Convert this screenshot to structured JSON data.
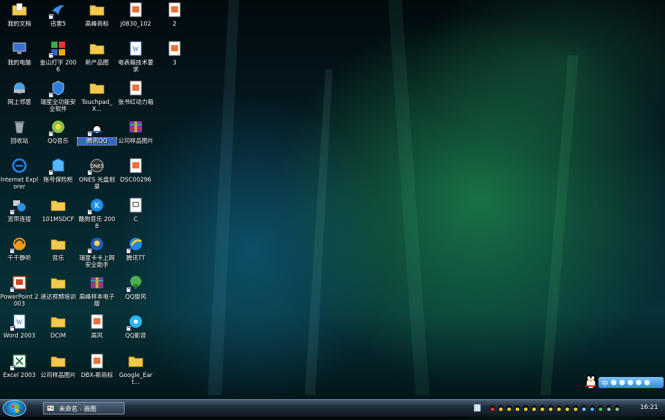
{
  "desktop": {
    "col1": [
      {
        "label": "我的文档",
        "icon": "documents-folder-icon",
        "shortcut": false
      },
      {
        "label": "我的电脑",
        "icon": "computer-icon",
        "shortcut": false
      },
      {
        "label": "网上邻居",
        "icon": "network-icon",
        "shortcut": false
      },
      {
        "label": "回收站",
        "icon": "recycle-bin-icon",
        "shortcut": false
      },
      {
        "label": "Internet Explorer",
        "icon": "internet-explorer-icon",
        "shortcut": false
      },
      {
        "label": "宽带连接",
        "icon": "broadband-connection-icon",
        "shortcut": true
      },
      {
        "label": "千千静听",
        "icon": "ttplayer-icon",
        "shortcut": true
      },
      {
        "label": "PowerPoint 2003",
        "icon": "powerpoint-icon",
        "shortcut": true
      },
      {
        "label": "Word 2003",
        "icon": "word-icon",
        "shortcut": true
      },
      {
        "label": "Excel 2003",
        "icon": "excel-icon",
        "shortcut": true
      }
    ],
    "col2": [
      {
        "label": "迅雷5",
        "icon": "thunder-icon",
        "shortcut": true
      },
      {
        "label": "金山打字 2006",
        "icon": "kingsoft-typing-icon",
        "shortcut": true
      },
      {
        "label": "瑞星全功能安全软件",
        "icon": "rising-security-icon",
        "shortcut": true
      },
      {
        "label": "QQ音乐",
        "icon": "qq-music-icon",
        "shortcut": true
      },
      {
        "label": "账号保险柜",
        "icon": "account-safe-icon",
        "shortcut": true
      },
      {
        "label": "101MSDCF",
        "icon": "folder-icon",
        "shortcut": false
      },
      {
        "label": "音乐",
        "icon": "folder-icon",
        "shortcut": false
      },
      {
        "label": "速达视频培训",
        "icon": "folder-icon",
        "shortcut": false
      },
      {
        "label": "DCIM",
        "icon": "folder-icon",
        "shortcut": false
      },
      {
        "label": "公司样品图片",
        "icon": "folder-icon",
        "shortcut": false
      }
    ],
    "col3": [
      {
        "label": "高峰商标",
        "icon": "folder-icon",
        "shortcut": false
      },
      {
        "label": "新产品图",
        "icon": "folder-icon",
        "shortcut": false
      },
      {
        "label": "Touchpad_X...",
        "icon": "folder-icon",
        "shortcut": false
      },
      {
        "label": "腾讯QQ",
        "icon": "qq-penguin-icon",
        "shortcut": true,
        "selected": true
      },
      {
        "label": "ONES 光盘刻录",
        "icon": "ones-burner-icon",
        "shortcut": true
      },
      {
        "label": "酷狗音乐 2008",
        "icon": "kugou-icon",
        "shortcut": true
      },
      {
        "label": "瑞星卡卡上网安全助手",
        "icon": "rising-kaka-icon",
        "shortcut": true
      },
      {
        "label": "高峰样本电子版",
        "icon": "winrar-archive-icon",
        "shortcut": false
      },
      {
        "label": "高风",
        "icon": "image-file-icon",
        "shortcut": false
      },
      {
        "label": "DBX-新商标",
        "icon": "image-file-icon",
        "shortcut": false
      }
    ],
    "col4": [
      {
        "label": "j0830_102",
        "icon": "image-file-icon",
        "shortcut": false
      },
      {
        "label": "电表箱技术要求",
        "icon": "word-document-icon",
        "shortcut": false
      },
      {
        "label": "张书红动力箱",
        "icon": "image-file-icon",
        "shortcut": false
      },
      {
        "label": "公司样品图片",
        "icon": "winrar-archive-icon",
        "shortcut": false
      },
      {
        "label": "DSC00296",
        "icon": "image-file-icon",
        "shortcut": false
      },
      {
        "label": "C",
        "icon": "generic-file-icon",
        "shortcut": false
      },
      {
        "label": "腾讯TT",
        "icon": "tencent-tt-icon",
        "shortcut": true
      },
      {
        "label": "QQ旋风",
        "icon": "qq-whirlwind-icon",
        "shortcut": true
      },
      {
        "label": "QQ影音",
        "icon": "qq-player-icon",
        "shortcut": true
      },
      {
        "label": "Google_Eart...",
        "icon": "folder-icon",
        "shortcut": false
      }
    ],
    "col5": [
      {
        "label": "2",
        "icon": "image-file-icon",
        "shortcut": false
      },
      {
        "label": "3",
        "icon": "image-file-icon",
        "shortcut": false
      }
    ]
  },
  "taskbar": {
    "task_label": "未命名 - 画图",
    "clock": "16:21"
  },
  "ime": {
    "lang": "中"
  },
  "colors": {
    "folder": "#f2c94c",
    "selection": "#316ac5",
    "taskbar": "#1f2e3d"
  }
}
